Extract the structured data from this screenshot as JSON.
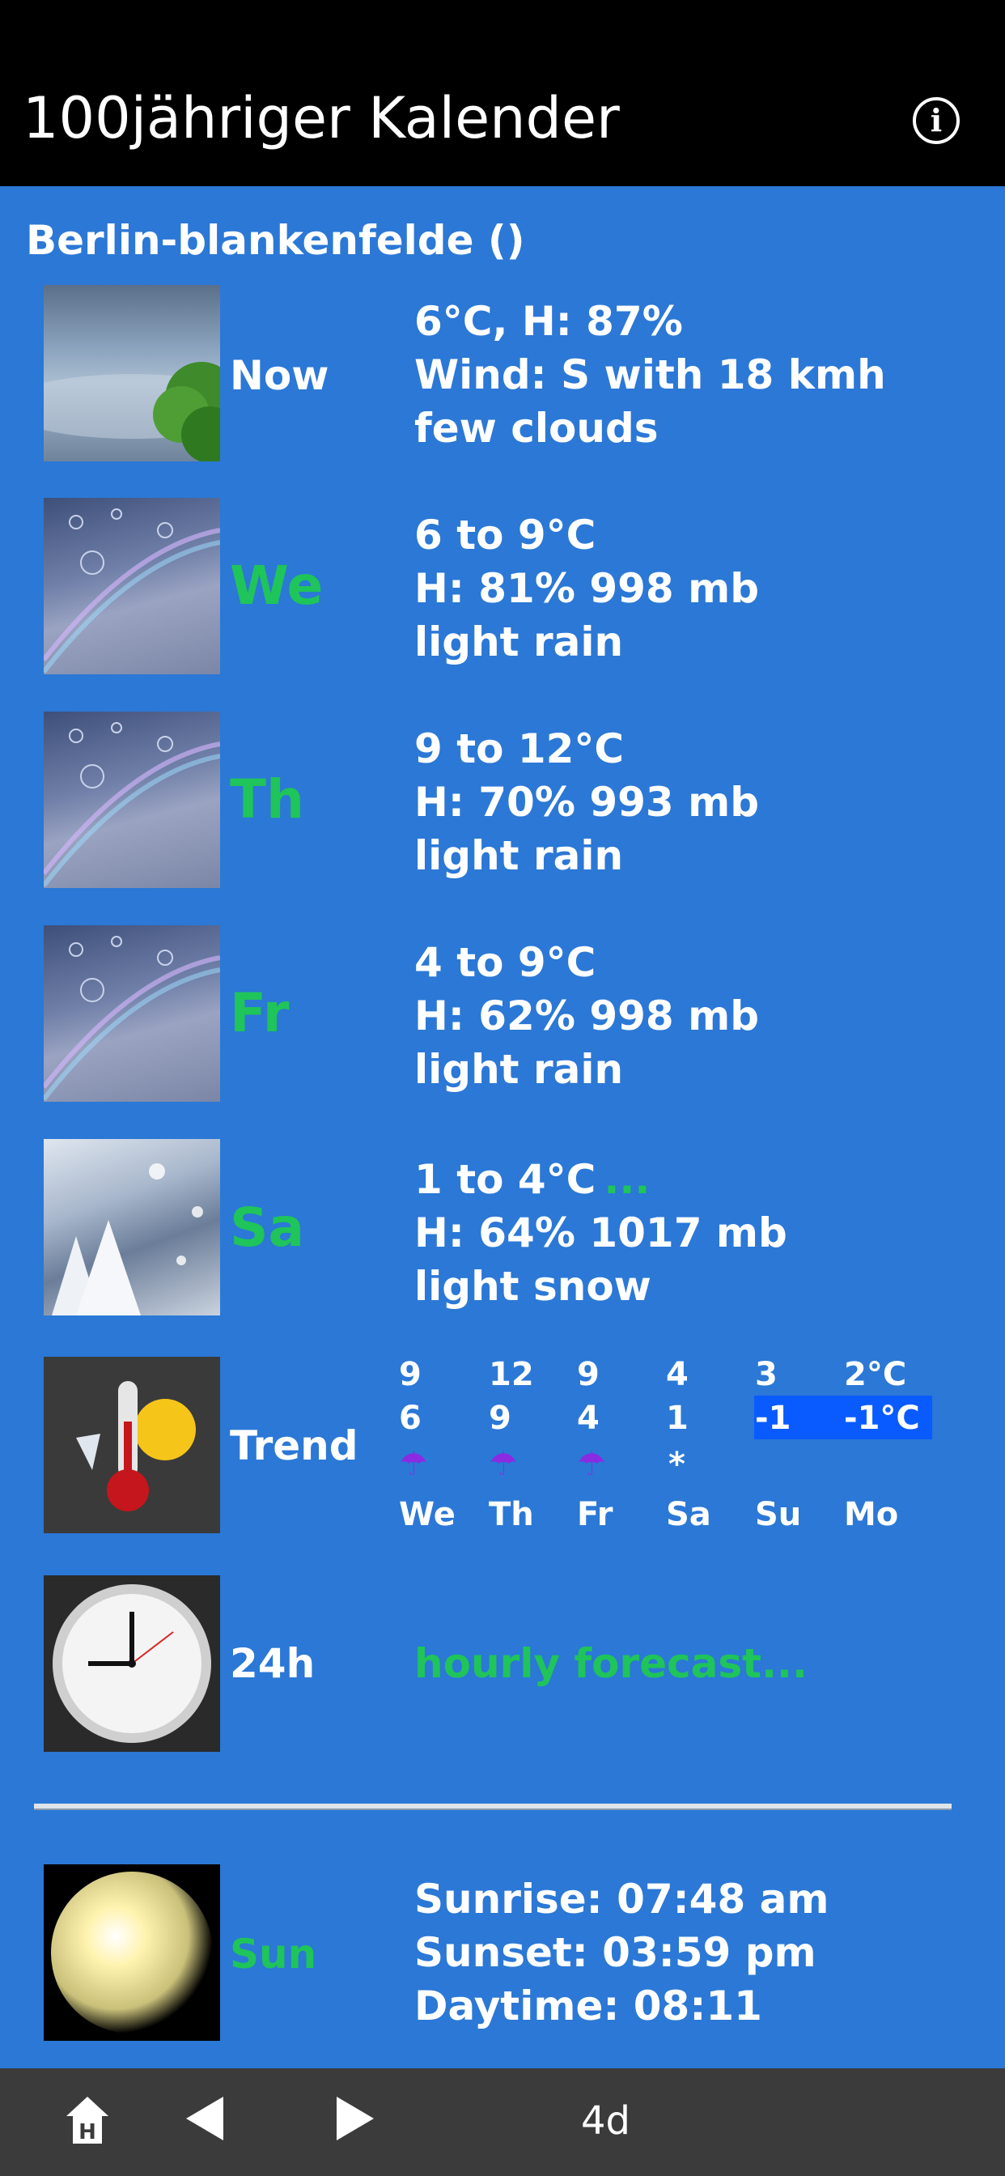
{
  "header": {
    "title": "100jähriger Kalender",
    "info_icon": "info-icon"
  },
  "location": "Berlin-blankenfelde ()",
  "rows": [
    {
      "label": "Now",
      "lines": [
        "6°C, H: 87%",
        "Wind: S with 18 kmh",
        "few clouds"
      ]
    },
    {
      "label": "We",
      "lines": [
        "6 to 9°C",
        "H: 81% 998 mb",
        "light rain"
      ]
    },
    {
      "label": "Th",
      "lines": [
        "9 to 12°C",
        "H: 70% 993 mb",
        "light rain"
      ]
    },
    {
      "label": "Fr",
      "lines": [
        "4 to 9°C",
        "H: 62% 998 mb",
        "light rain"
      ]
    },
    {
      "label": "Sa",
      "lines": [
        "1 to 4°C",
        "H: 64% 1017 mb",
        "light snow"
      ],
      "more": "..."
    }
  ],
  "trend": {
    "label": "Trend",
    "highs": [
      "9",
      "12",
      "9",
      "4",
      "3",
      "2°C"
    ],
    "lows": [
      "6",
      "9",
      "4",
      "1",
      "-1",
      "-1°C"
    ],
    "symbols": [
      "☂",
      "☂",
      "☂",
      "*",
      "",
      ""
    ],
    "days": [
      "We",
      "Th",
      "Fr",
      "Sa",
      "Su",
      "Mo"
    ]
  },
  "hourly": {
    "label": "24h",
    "link": "hourly forecast..."
  },
  "sun": {
    "label": "Sun",
    "sunrise": "Sunrise: 07:48 am",
    "sunset": "Sunset: 03:59 pm",
    "daytime": "Daytime: 08:11"
  },
  "bottom_nav": {
    "home_icon": "home-icon",
    "back_icon": "back-icon",
    "forward_icon": "forward-icon",
    "current": "4d"
  },
  "colors": {
    "background": "#2b78d6",
    "accent_green": "#1fc45a",
    "highlight": "#0a5bff",
    "header": "#000000",
    "bottom_bar": "#3b3b3b"
  }
}
